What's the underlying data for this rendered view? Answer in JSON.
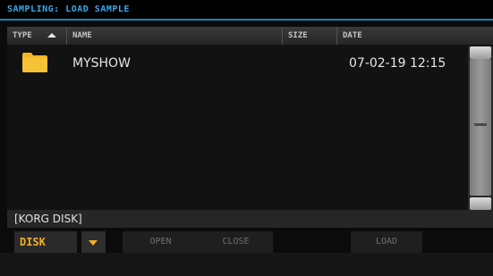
{
  "window": {
    "title": "SAMPLING: LOAD SAMPLE"
  },
  "columns": {
    "type": "TYPE",
    "name": "NAME",
    "size": "SIZE",
    "date": "DATE"
  },
  "files": [
    {
      "type_icon": "folder-icon",
      "name": "MYSHOW",
      "size": "",
      "date": "07-02-19 12:15"
    }
  ],
  "path": "[KORG DISK]",
  "buttons": {
    "disk": "DISK",
    "open": "OPEN",
    "close": "CLOSE",
    "load": "LOAD"
  },
  "colors": {
    "title": "#39a7ea",
    "accent_border": "#1e7fc0",
    "folder": "#f5b822",
    "disk_label": "#f2b023"
  }
}
